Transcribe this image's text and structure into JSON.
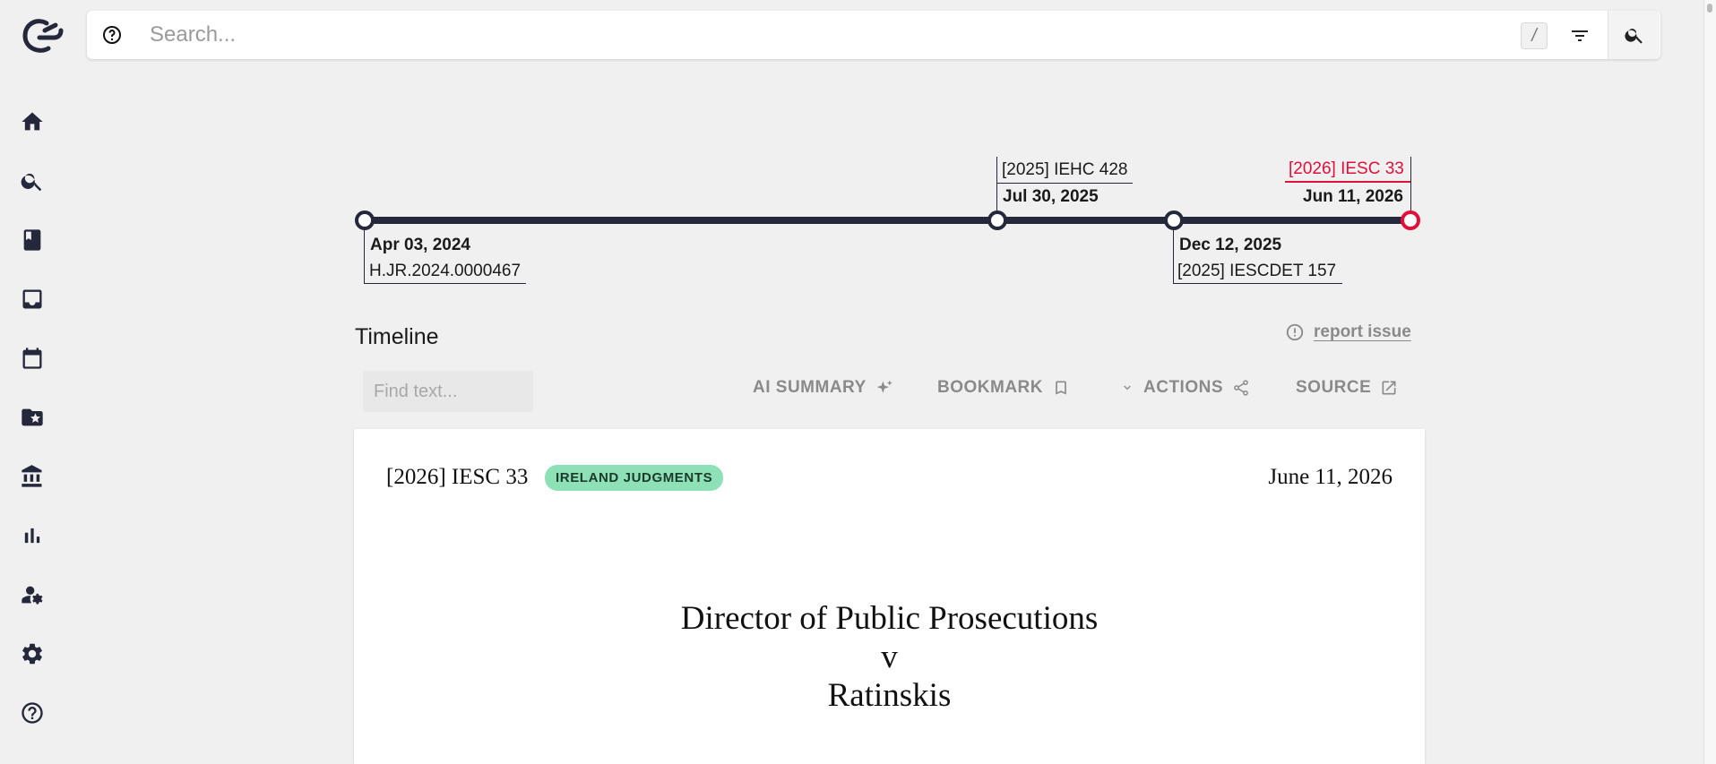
{
  "search": {
    "placeholder": "Search...",
    "shortcut": "/"
  },
  "sidebar": {
    "items": [
      {
        "name": "home-icon"
      },
      {
        "name": "search-icon"
      },
      {
        "name": "book-icon"
      },
      {
        "name": "inbox-icon"
      },
      {
        "name": "calendar-icon"
      },
      {
        "name": "starred-folder-icon"
      },
      {
        "name": "institution-icon"
      },
      {
        "name": "bar-chart-icon"
      },
      {
        "name": "person-edit-icon"
      },
      {
        "name": "gear-icon"
      },
      {
        "name": "help-icon"
      }
    ]
  },
  "timeline": {
    "title": "Timeline",
    "events": [
      {
        "date": "Apr 03, 2024",
        "ref": "H.JR.2024.0000467"
      },
      {
        "date": "Jul 30, 2025",
        "ref": "[2025] IEHC 428"
      },
      {
        "date": "Dec 12, 2025",
        "ref": "[2025] IESCDET 157"
      },
      {
        "date": "Jun 11, 2026",
        "ref": "[2026] IESC 33",
        "current": true
      }
    ],
    "current_color": "#e0103a"
  },
  "report_issue": "report issue",
  "toolbar": {
    "find_placeholder": "Find text...",
    "ai_summary": "AI SUMMARY",
    "bookmark": "BOOKMARK",
    "actions": "ACTIONS",
    "source": "SOURCE"
  },
  "document": {
    "citation": "[2026] IESC 33",
    "badge": "IRELAND JUDGMENTS",
    "badge_color": "#8ee0b6",
    "date": "June 11, 2026",
    "title_line1": "Director of Public Prosecutions",
    "title_line2": "v",
    "title_line3": "Ratinskis"
  }
}
